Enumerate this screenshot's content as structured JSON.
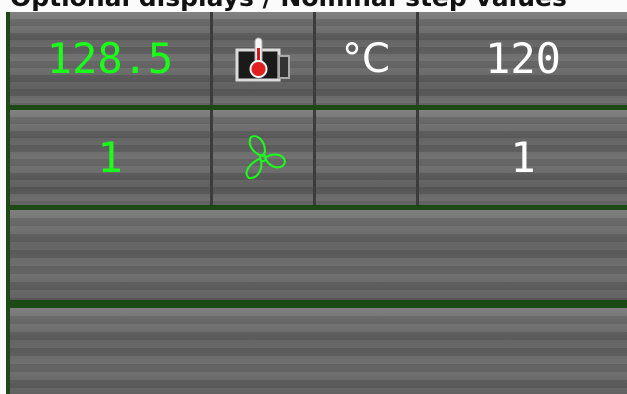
{
  "header": {
    "title": "Optional displays / Nominal step values"
  },
  "rows": [
    {
      "actual_value": "128.5",
      "actual_color": "#19ff19",
      "icon": "heating-thermometer-icon",
      "unit": "°C",
      "nominal_value": "120",
      "nominal_color": "#ffffff"
    },
    {
      "actual_value": "1",
      "actual_color": "#19ff19",
      "icon": "fan-icon",
      "unit": "",
      "nominal_value": "1",
      "nominal_color": "#ffffff"
    }
  ],
  "colors": {
    "panel_border": "#1d4a14",
    "active_green": "#19ff19"
  }
}
